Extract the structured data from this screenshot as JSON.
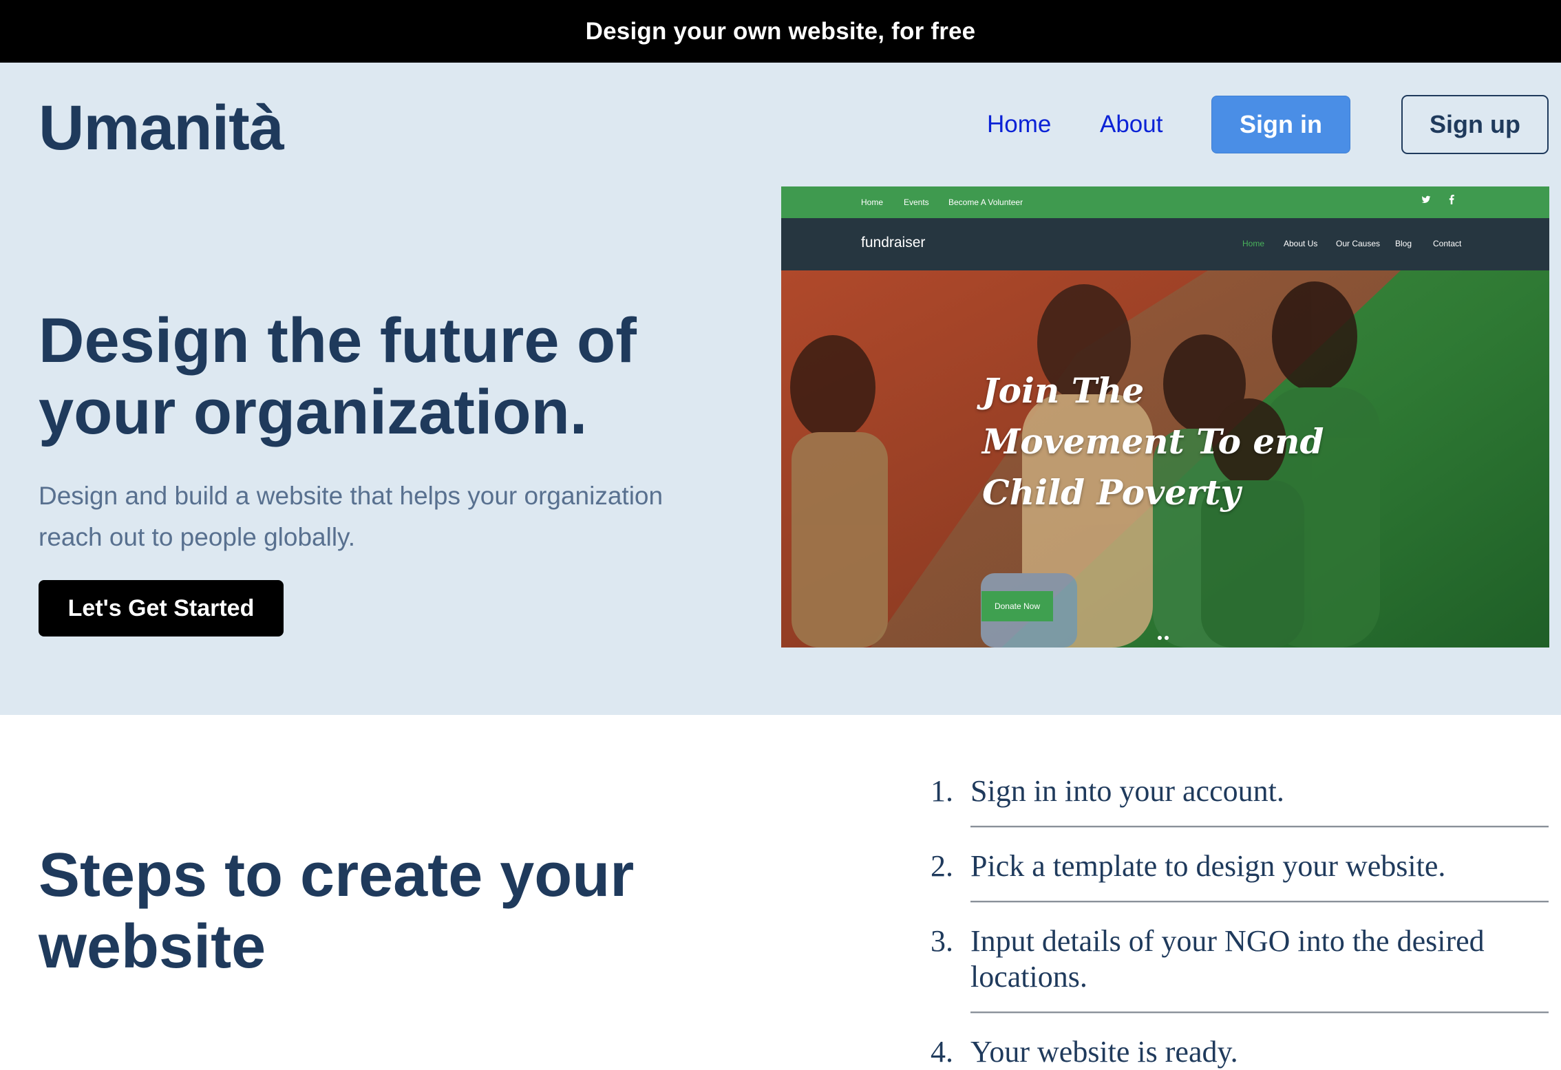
{
  "banner": {
    "text": "Design your own website, for free"
  },
  "header": {
    "logo": "Umanità",
    "nav": {
      "home": "Home",
      "about": "About"
    },
    "signin_label": "Sign in",
    "signup_label": "Sign up"
  },
  "hero": {
    "title": "Design the future of your organization.",
    "subtitle": "Design and build a website that helps your organization reach out to people globally.",
    "cta_label": "Let's Get Started"
  },
  "preview": {
    "topbar_links": [
      "Home",
      "Events",
      "Become A Volunteer"
    ],
    "social_icons": [
      "twitter-icon",
      "facebook-icon"
    ],
    "brand": "fundraiser",
    "nav_links": [
      "Home",
      "About Us",
      "Our Causes",
      "Blog",
      "Contact"
    ],
    "headline_lines": [
      "Join The",
      "Movement To end",
      "Child Poverty"
    ],
    "donate_label": "Donate Now",
    "colors": {
      "topbar": "#3f9a4f",
      "nav": "#263640",
      "active_link": "#49b35b"
    }
  },
  "steps": {
    "title": "Steps to create your website",
    "items": [
      {
        "num": "1.",
        "text": "Sign in into your account."
      },
      {
        "num": "2.",
        "text": "Pick a template to design your website."
      },
      {
        "num": "3.",
        "text": "Input details of your NGO into the desired locations."
      },
      {
        "num": "4.",
        "text": "Your website is ready."
      }
    ]
  },
  "colors": {
    "banner_bg": "#000000",
    "hero_bg": "#dde8f1",
    "primary_text": "#1f3a5c",
    "link": "#0b22d6",
    "signin_bg": "#4a8ee6"
  }
}
